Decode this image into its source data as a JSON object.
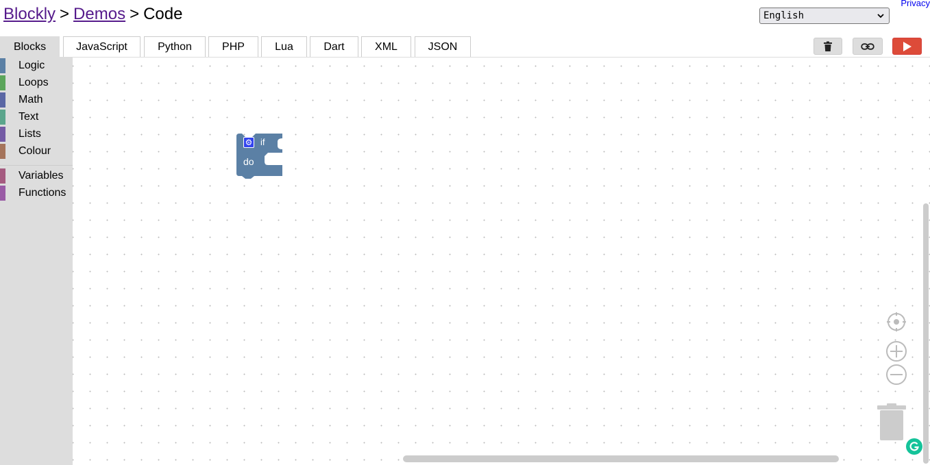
{
  "breadcrumb": {
    "items": [
      "Blockly",
      "Demos"
    ],
    "separator": ">",
    "current": "Code"
  },
  "privacy_link": "Privacy",
  "language_select": {
    "value": "English"
  },
  "tabs": [
    "Blocks",
    "JavaScript",
    "Python",
    "PHP",
    "Lua",
    "Dart",
    "XML",
    "JSON"
  ],
  "active_tab": "Blocks",
  "toolbar": {
    "trash_icon": "trash-icon",
    "link_icon": "link-icon",
    "run_icon": "play-icon"
  },
  "toolbox": {
    "categories": [
      {
        "label": "Logic",
        "color": "#5b80a5"
      },
      {
        "label": "Loops",
        "color": "#5ba55b"
      },
      {
        "label": "Math",
        "color": "#5b67a5"
      },
      {
        "label": "Text",
        "color": "#5ba58c"
      },
      {
        "label": "Lists",
        "color": "#745ba5"
      },
      {
        "label": "Colour",
        "color": "#a5745b"
      },
      {
        "label": "Variables",
        "color": "#a55b80"
      },
      {
        "label": "Functions",
        "color": "#995ba5"
      }
    ]
  },
  "block": {
    "if_label": "if",
    "do_label": "do",
    "color": "#5b80a5"
  },
  "colors": {
    "run_button": "#dd4b39",
    "visited_link": "#551a8b",
    "grammarly": "#15c39a"
  }
}
